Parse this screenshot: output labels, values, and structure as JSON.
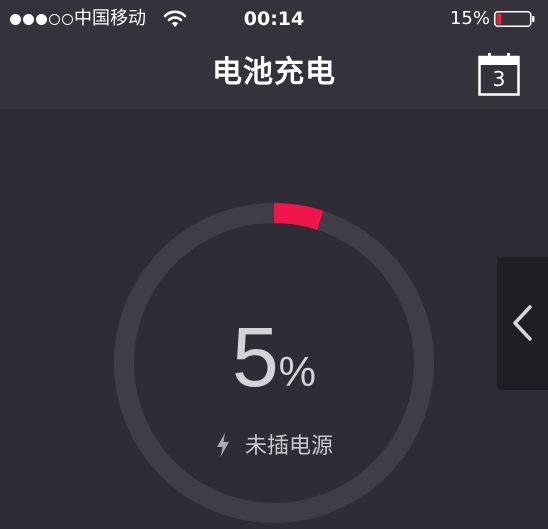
{
  "status_bar": {
    "signal_dots": [
      true,
      true,
      true,
      false,
      false
    ],
    "carrier": "中国移动",
    "wifi_icon": "wifi-icon",
    "time": "00:14",
    "battery_percent": "15%",
    "battery_level": 0.15,
    "battery_color": "#e8203a"
  },
  "nav": {
    "title": "电池充电",
    "calendar_icon": "calendar-icon",
    "calendar_day": "3"
  },
  "gauge": {
    "level": 0.05,
    "value": "5",
    "unit": "%",
    "status": "未插电源",
    "status_icon": "lightning-bolt-icon",
    "ring_color": "#3f3d45",
    "progress_color": "#f0154a"
  },
  "side_tab": {
    "icon": "chevron-left-icon"
  }
}
